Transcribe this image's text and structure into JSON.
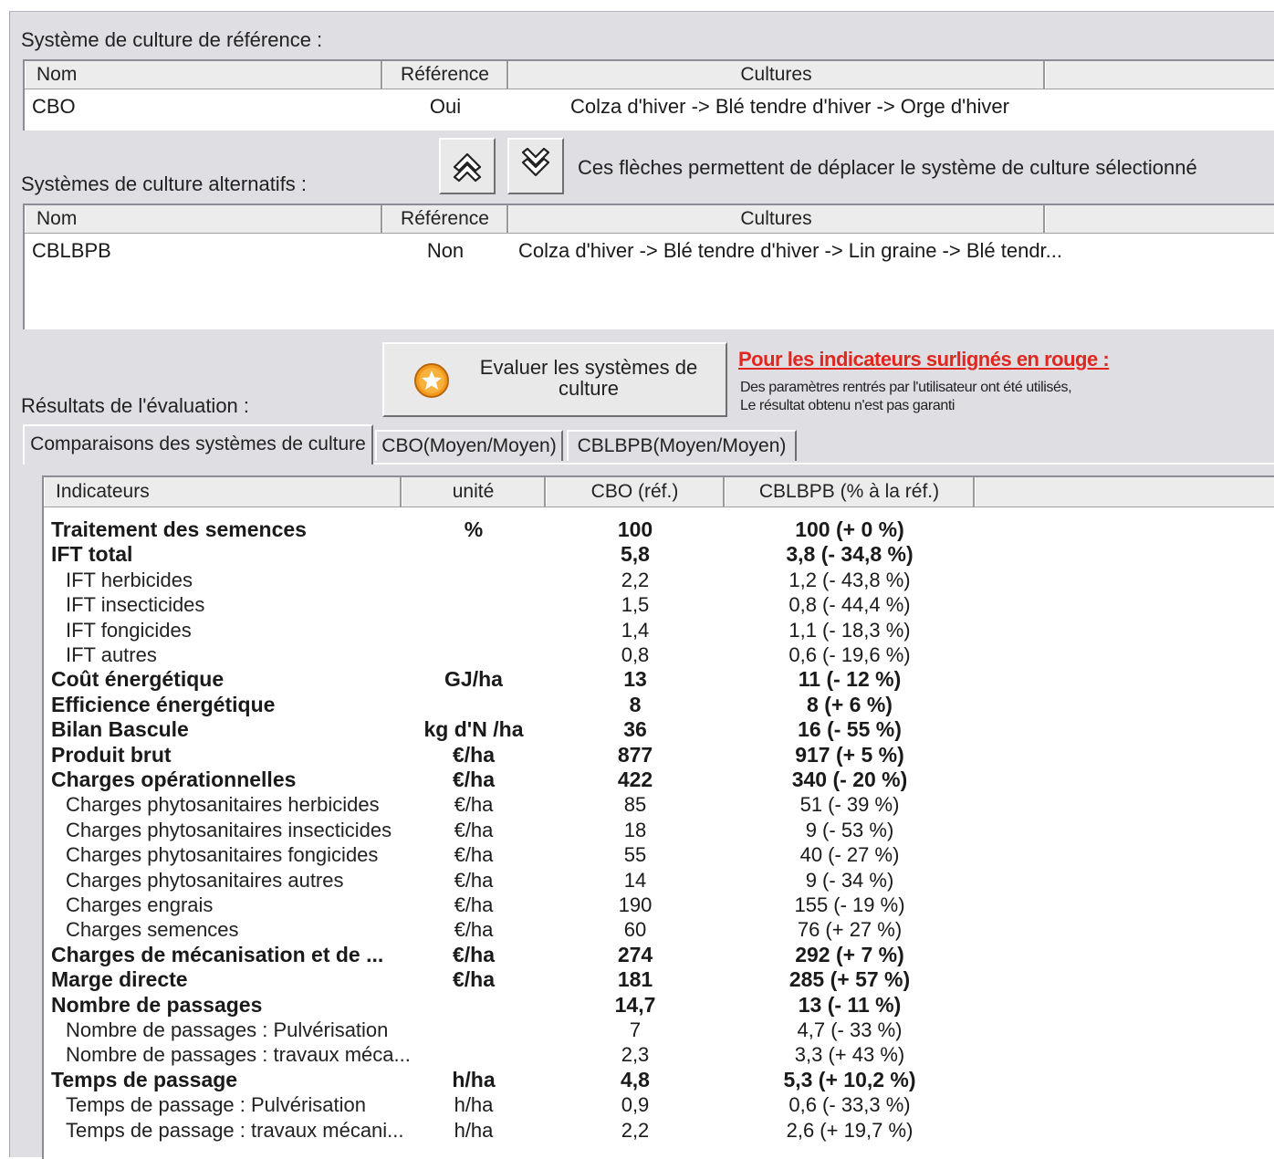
{
  "reference_section": {
    "label": "Système de culture de référence :",
    "columns": [
      "Nom",
      "Référence",
      "Cultures"
    ],
    "rows": [
      {
        "nom": "CBO",
        "reference": "Oui",
        "cultures": "Colza d'hiver -> Blé tendre d'hiver -> Orge d'hiver"
      }
    ]
  },
  "alternatives_section": {
    "label": "Systèmes de culture alternatifs :",
    "move_hint": "Ces flèches permettent de déplacer le système de culture sélectionné",
    "up_icon": "double-chevron-up-icon",
    "down_icon": "double-chevron-down-icon",
    "columns": [
      "Nom",
      "Référence",
      "Cultures"
    ],
    "rows": [
      {
        "nom": "CBLBPB",
        "reference": "Non",
        "cultures": "Colza d'hiver -> Blé tendre d'hiver -> Lin graine -> Blé tendr..."
      }
    ]
  },
  "evaluate_button": {
    "label_line1": "Evaluer les systèmes de",
    "label_line2": "culture",
    "icon": "orange-star-icon"
  },
  "warning": {
    "title": "Pour les indicateurs surlignés en rouge :",
    "line1": "Des paramètres rentrés par l'utilisateur ont été utilisés,",
    "line2": "Le résultat obtenu n'est pas garanti",
    "color": "#e0261e"
  },
  "results_label": "Résultats de l'évaluation :",
  "tabs": [
    {
      "label": "Comparaisons des systèmes de culture",
      "active": true
    },
    {
      "label": "CBO(Moyen/Moyen)",
      "active": false
    },
    {
      "label": "CBLBPB(Moyen/Moyen)",
      "active": false
    }
  ],
  "results_table": {
    "columns": [
      "Indicateurs",
      "unité",
      "CBO (réf.)",
      "CBLBPB (% à la réf.)"
    ],
    "rows": [
      {
        "name": "Traitement des semences",
        "unit": "%",
        "ref": "100",
        "alt": "100 (+ 0 %)",
        "bold": true
      },
      {
        "name": "IFT total",
        "unit": "",
        "ref": "5,8",
        "alt": "3,8 (- 34,8 %)",
        "bold": true
      },
      {
        "name": "IFT herbicides",
        "unit": "",
        "ref": "2,2",
        "alt": "1,2 (- 43,8 %)",
        "bold": false
      },
      {
        "name": "IFT insecticides",
        "unit": "",
        "ref": "1,5",
        "alt": "0,8 (- 44,4 %)",
        "bold": false
      },
      {
        "name": "IFT fongicides",
        "unit": "",
        "ref": "1,4",
        "alt": "1,1 (- 18,3 %)",
        "bold": false
      },
      {
        "name": "IFT autres",
        "unit": "",
        "ref": "0,8",
        "alt": "0,6 (- 19,6 %)",
        "bold": false
      },
      {
        "name": "Coût énergétique",
        "unit": "GJ/ha",
        "ref": "13",
        "alt": "11 (- 12 %)",
        "bold": true
      },
      {
        "name": "Efficience énergétique",
        "unit": "",
        "ref": "8",
        "alt": "8 (+ 6 %)",
        "bold": true
      },
      {
        "name": "Bilan Bascule",
        "unit": "kg d'N /ha",
        "ref": "36",
        "alt": "16 (- 55 %)",
        "bold": true
      },
      {
        "name": "Produit brut",
        "unit": "€/ha",
        "ref": "877",
        "alt": "917 (+ 5 %)",
        "bold": true
      },
      {
        "name": "Charges opérationnelles",
        "unit": "€/ha",
        "ref": "422",
        "alt": "340 (- 20 %)",
        "bold": true
      },
      {
        "name": "Charges phytosanitaires herbicides",
        "unit": "€/ha",
        "ref": "85",
        "alt": "51 (- 39 %)",
        "bold": false
      },
      {
        "name": "Charges phytosanitaires insecticides",
        "unit": "€/ha",
        "ref": "18",
        "alt": "9 (- 53 %)",
        "bold": false
      },
      {
        "name": "Charges phytosanitaires fongicides",
        "unit": "€/ha",
        "ref": "55",
        "alt": "40 (- 27 %)",
        "bold": false
      },
      {
        "name": "Charges phytosanitaires autres",
        "unit": "€/ha",
        "ref": "14",
        "alt": "9 (- 34 %)",
        "bold": false
      },
      {
        "name": "Charges engrais",
        "unit": "€/ha",
        "ref": "190",
        "alt": "155 (- 19 %)",
        "bold": false
      },
      {
        "name": "Charges semences",
        "unit": "€/ha",
        "ref": "60",
        "alt": "76 (+ 27 %)",
        "bold": false
      },
      {
        "name": "Charges de mécanisation et de ...",
        "unit": "€/ha",
        "ref": "274",
        "alt": "292 (+ 7 %)",
        "bold": true
      },
      {
        "name": "Marge directe",
        "unit": "€/ha",
        "ref": "181",
        "alt": "285 (+ 57 %)",
        "bold": true
      },
      {
        "name": "Nombre de passages",
        "unit": "",
        "ref": "14,7",
        "alt": "13 (- 11 %)",
        "bold": true
      },
      {
        "name": "Nombre de passages : Pulvérisation",
        "unit": "",
        "ref": "7",
        "alt": "4,7 (- 33 %)",
        "bold": false
      },
      {
        "name": "Nombre de passages : travaux méca...",
        "unit": "",
        "ref": "2,3",
        "alt": "3,3 (+ 43 %)",
        "bold": false
      },
      {
        "name": "Temps de passage",
        "unit": "h/ha",
        "ref": "4,8",
        "alt": "5,3 (+ 10,2 %)",
        "bold": true
      },
      {
        "name": "Temps de passage : Pulvérisation",
        "unit": "h/ha",
        "ref": "0,9",
        "alt": "0,6 (- 33,3 %)",
        "bold": false
      },
      {
        "name": "Temps de passage : travaux mécani...",
        "unit": "h/ha",
        "ref": "2,2",
        "alt": "2,6 (+ 19,7 %)",
        "bold": false
      }
    ]
  }
}
